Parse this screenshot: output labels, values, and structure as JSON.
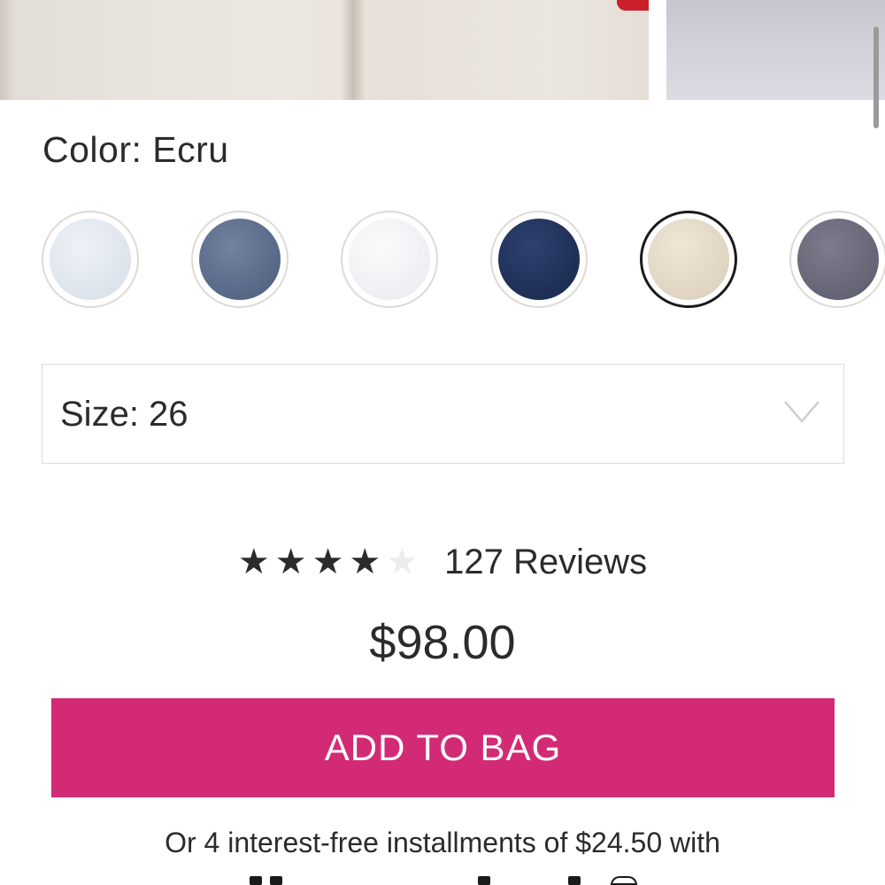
{
  "color": {
    "label": "Color: Ecru",
    "swatches": [
      {
        "name": "Light Wash",
        "hex": "#dfe6ee",
        "selected": false
      },
      {
        "name": "Medium Wash",
        "hex": "#5d6f8e",
        "selected": false
      },
      {
        "name": "White",
        "hex": "#f3f1f4",
        "selected": false
      },
      {
        "name": "Dark Wash",
        "hex": "#23355a",
        "selected": false
      },
      {
        "name": "Ecru",
        "hex": "#e6dccb",
        "selected": true
      },
      {
        "name": "Grey",
        "hex": "#6b6b7c",
        "selected": false
      }
    ]
  },
  "size": {
    "label": "Size: 26"
  },
  "rating": {
    "stars": 4,
    "max": 5,
    "reviews_label": "127 Reviews"
  },
  "price": "$98.00",
  "add_to_bag": {
    "label": "ADD TO BAG",
    "color": "#d32a75"
  },
  "installments": "Or 4 interest-free installments of $24.50 with"
}
